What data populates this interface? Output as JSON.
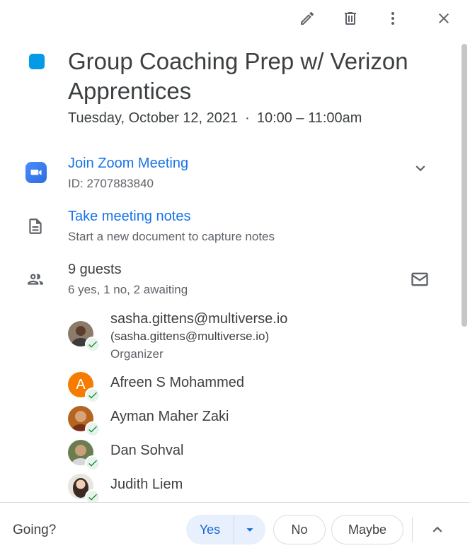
{
  "event": {
    "color": "#039be5",
    "title": "Group Coaching Prep w/ Verizon Apprentices",
    "date": "Tuesday, October 12, 2021",
    "separator": "·",
    "time": "10:00 – 11:00am"
  },
  "conference": {
    "label": "Join Zoom Meeting",
    "id_text": "ID: 2707883840"
  },
  "notes": {
    "label": "Take meeting notes",
    "description": "Start a new document to capture notes"
  },
  "guests": {
    "count_text": "9 guests",
    "summary": "6 yes, 1 no, 2 awaiting",
    "organizer": {
      "email": "sasha.gittens@multiverse.io",
      "email_paren": "(sasha.gittens@multiverse.io)",
      "role": "Organizer"
    },
    "list": [
      {
        "name": "Afreen S Mohammed",
        "initial": "A"
      },
      {
        "name": "Ayman Maher Zaki"
      },
      {
        "name": "Dan Sohval"
      },
      {
        "name": "Judith Liem"
      }
    ]
  },
  "footer": {
    "going_label": "Going?",
    "yes": "Yes",
    "no": "No",
    "maybe": "Maybe"
  }
}
